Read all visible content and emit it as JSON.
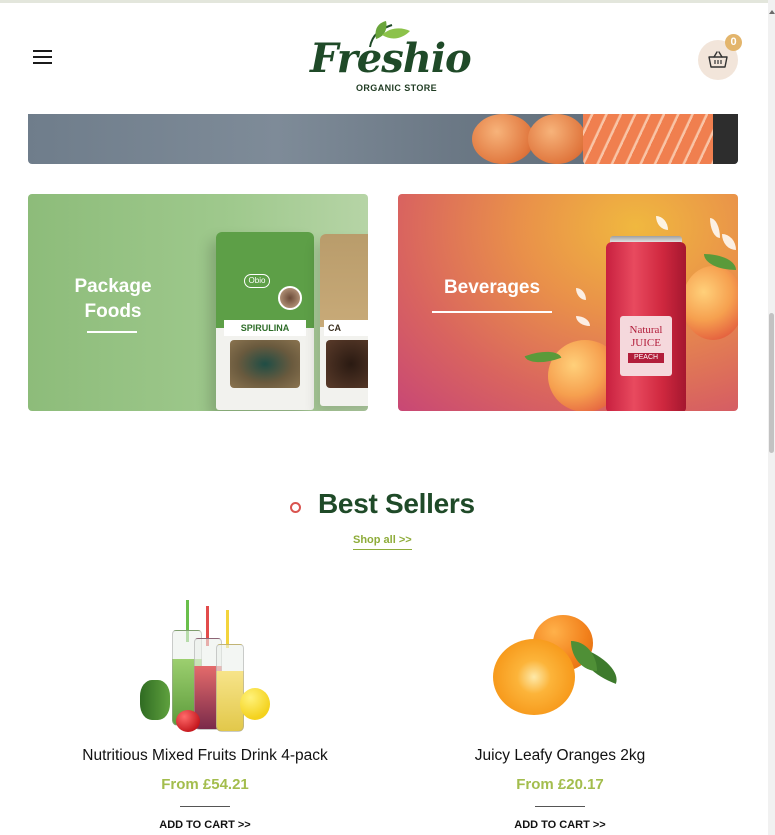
{
  "header": {
    "menu_icon": "hamburger-icon",
    "logo": {
      "word": "Freshio",
      "subtitle": "ORGANIC STORE"
    },
    "cart": {
      "icon": "basket-icon",
      "count": "0"
    }
  },
  "hero": {
    "description_icon": "food-banner"
  },
  "categories": [
    {
      "title_line1": "Package",
      "title_line2": "Foods"
    },
    {
      "title": "Beverages"
    }
  ],
  "packaging": {
    "brand": "Obio",
    "product_a": "SPIRULINA",
    "product_b": "CA"
  },
  "juice_label": {
    "line1": "Natural",
    "line2": "JUICE",
    "line3": "PEACH"
  },
  "best_sellers": {
    "title": "Best Sellers",
    "shop_all": "Shop all >>"
  },
  "products": [
    {
      "name": "Nutritious Mixed Fruits Drink 4-pack",
      "price": "From £54.21",
      "cta": "ADD TO CART >>"
    },
    {
      "name": "Juicy Leafy Oranges 2kg",
      "price": "From £20.17",
      "cta": "ADD TO CART >>"
    }
  ],
  "colors": {
    "brand_green": "#1f4a28",
    "accent_lime": "#a3bd4d",
    "badge": "#e3b56c"
  }
}
